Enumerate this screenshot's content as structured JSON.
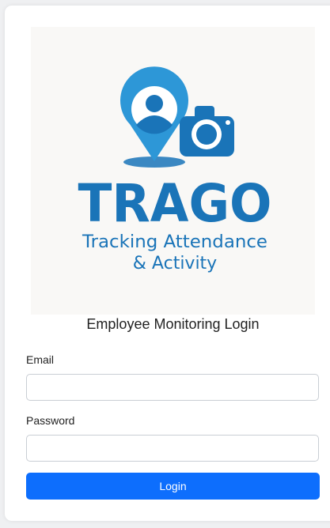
{
  "logo": {
    "brand": "TRAGO",
    "tagline_line1": "Tracking Attendance",
    "tagline_line2": "& Activity",
    "icons": [
      "location-pin-person-icon",
      "camera-icon"
    ],
    "colors": {
      "primary": "#1a74b8",
      "light_blue": "#2d97d7",
      "background": "#f9f8f6"
    }
  },
  "login": {
    "heading": "Employee Monitoring Login",
    "email_label": "Email",
    "email_value": "",
    "password_label": "Password",
    "password_value": "",
    "submit_label": "Login",
    "button_color": "#0d6efd"
  }
}
